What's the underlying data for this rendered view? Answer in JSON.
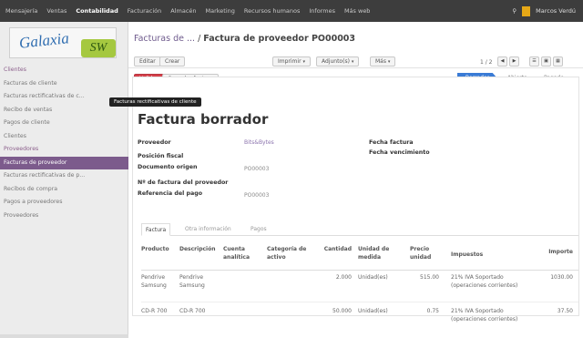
{
  "topbar": {
    "menu": [
      "Mensajería",
      "Ventas",
      "Contabilidad",
      "Facturación",
      "Almacén",
      "Marketing",
      "Recursos humanos",
      "Informes",
      "Más web"
    ],
    "active_index": 2,
    "user": "Marcos Verdú"
  },
  "logo": {
    "word": "Galaxia",
    "badge": "SW"
  },
  "sidebar": {
    "items": [
      {
        "label": "Clientes",
        "section": true
      },
      {
        "label": "Facturas de cliente"
      },
      {
        "label": "Facturas rectificativas de c..."
      },
      {
        "label": "Recibo de ventas"
      },
      {
        "label": "Pagos de cliente"
      },
      {
        "label": "Clientes"
      },
      {
        "label": "Proveedores",
        "section": true
      },
      {
        "label": "Facturas de proveedor",
        "active": true
      },
      {
        "label": "Facturas rectificativas de p..."
      },
      {
        "label": "Recibos de compra"
      },
      {
        "label": "Pagos a proveedores"
      },
      {
        "label": "Proveedores"
      }
    ],
    "tooltip": "Facturas rectificativas de cliente"
  },
  "breadcrumb": {
    "parent": "Facturas de ...",
    "separator": " / ",
    "current": "Factura de proveedor PO00003"
  },
  "toolbar": {
    "edit": "Editar",
    "create": "Crear",
    "print": "Imprimir",
    "attachments": "Adjunto(s)",
    "more": "Más",
    "pager": "1 / 2"
  },
  "actions": {
    "validate": "Validar",
    "cancel": "Cancelar factura"
  },
  "status": {
    "draft": "Borrador",
    "open": "Abierta",
    "paid": "Pagado"
  },
  "form": {
    "title": "Factura borrador",
    "fields": {
      "supplier_label": "Proveedor",
      "supplier_value": "Bits&Bytes",
      "fiscal_label": "Posición fiscal",
      "origin_label": "Documento origen",
      "origin_value": "PO00003",
      "supplier_number_label": "Nº de factura del proveedor",
      "payment_ref_label": "Referencia del pago",
      "payment_ref_value": "PO00003",
      "invoice_date_label": "Fecha factura",
      "due_date_label": "Fecha vencimiento"
    }
  },
  "tabs": [
    "Factura",
    "Otra información",
    "Pagos"
  ],
  "table": {
    "headers": {
      "product": "Producto",
      "description": "Descripción",
      "account": "Cuenta analítica",
      "asset": "Categoría de activo",
      "qty": "Cantidad",
      "uom": "Unidad de medida",
      "price": "Precio unidad",
      "taxes": "Impuestos",
      "amount": "Importe"
    },
    "rows": [
      {
        "product": "Pendrive Samsung",
        "description": "Pendrive Samsung",
        "qty": "2.000",
        "uom": "Unidad(es)",
        "price": "515.00",
        "taxes": "21% IVA Soportado (operaciones corrientes)",
        "amount": "1030.00"
      },
      {
        "product": "CD-R 700",
        "description": "CD-R 700",
        "qty": "50.000",
        "uom": "Unidad(es)",
        "price": "0.75",
        "taxes": "21% IVA Soportado (operaciones corrientes)",
        "amount": "37.50"
      }
    ]
  },
  "colors": {
    "topbar": "#3d3d3d",
    "active_menu": "#7c5b8c",
    "validate": "#d4404a",
    "draft": "#3a7bd5"
  }
}
